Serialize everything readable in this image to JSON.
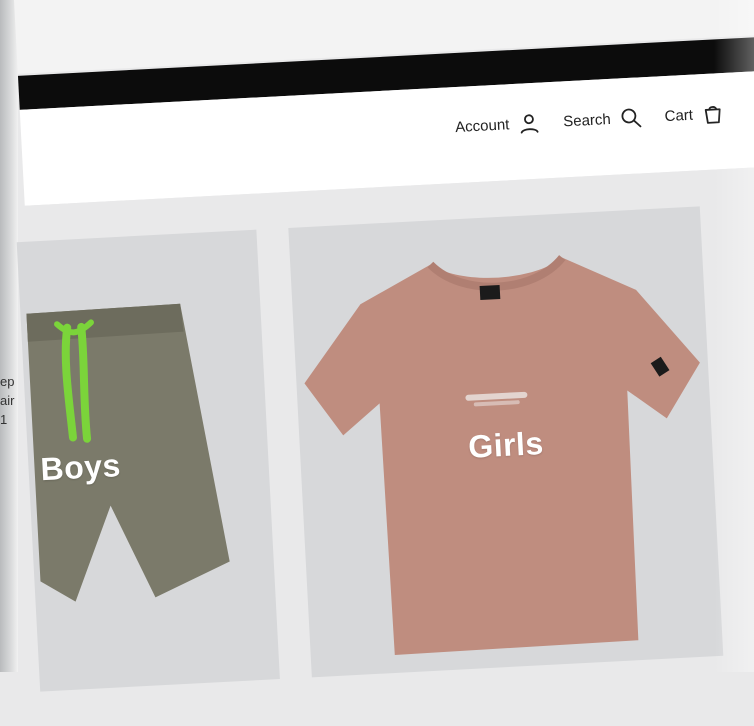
{
  "nav": {
    "account_label": "Account",
    "search_label": "Search",
    "cart_label": "Cart"
  },
  "cards": {
    "boys": {
      "label": "Boys"
    },
    "girls": {
      "label": "Girls"
    }
  },
  "sidebar": {
    "snippet": "ep\nair\n1"
  },
  "colors": {
    "top_bar": "#0c0c0c",
    "header_bg": "#ffffff",
    "page_bg": "#e9e9ea",
    "card_bg": "#d7d8da",
    "shorts": "#7b7a6a",
    "drawstring": "#7bd43a",
    "tee": "#bf8d7f"
  },
  "icons": {
    "account": "account-icon",
    "search": "search-icon",
    "cart": "cart-icon"
  }
}
